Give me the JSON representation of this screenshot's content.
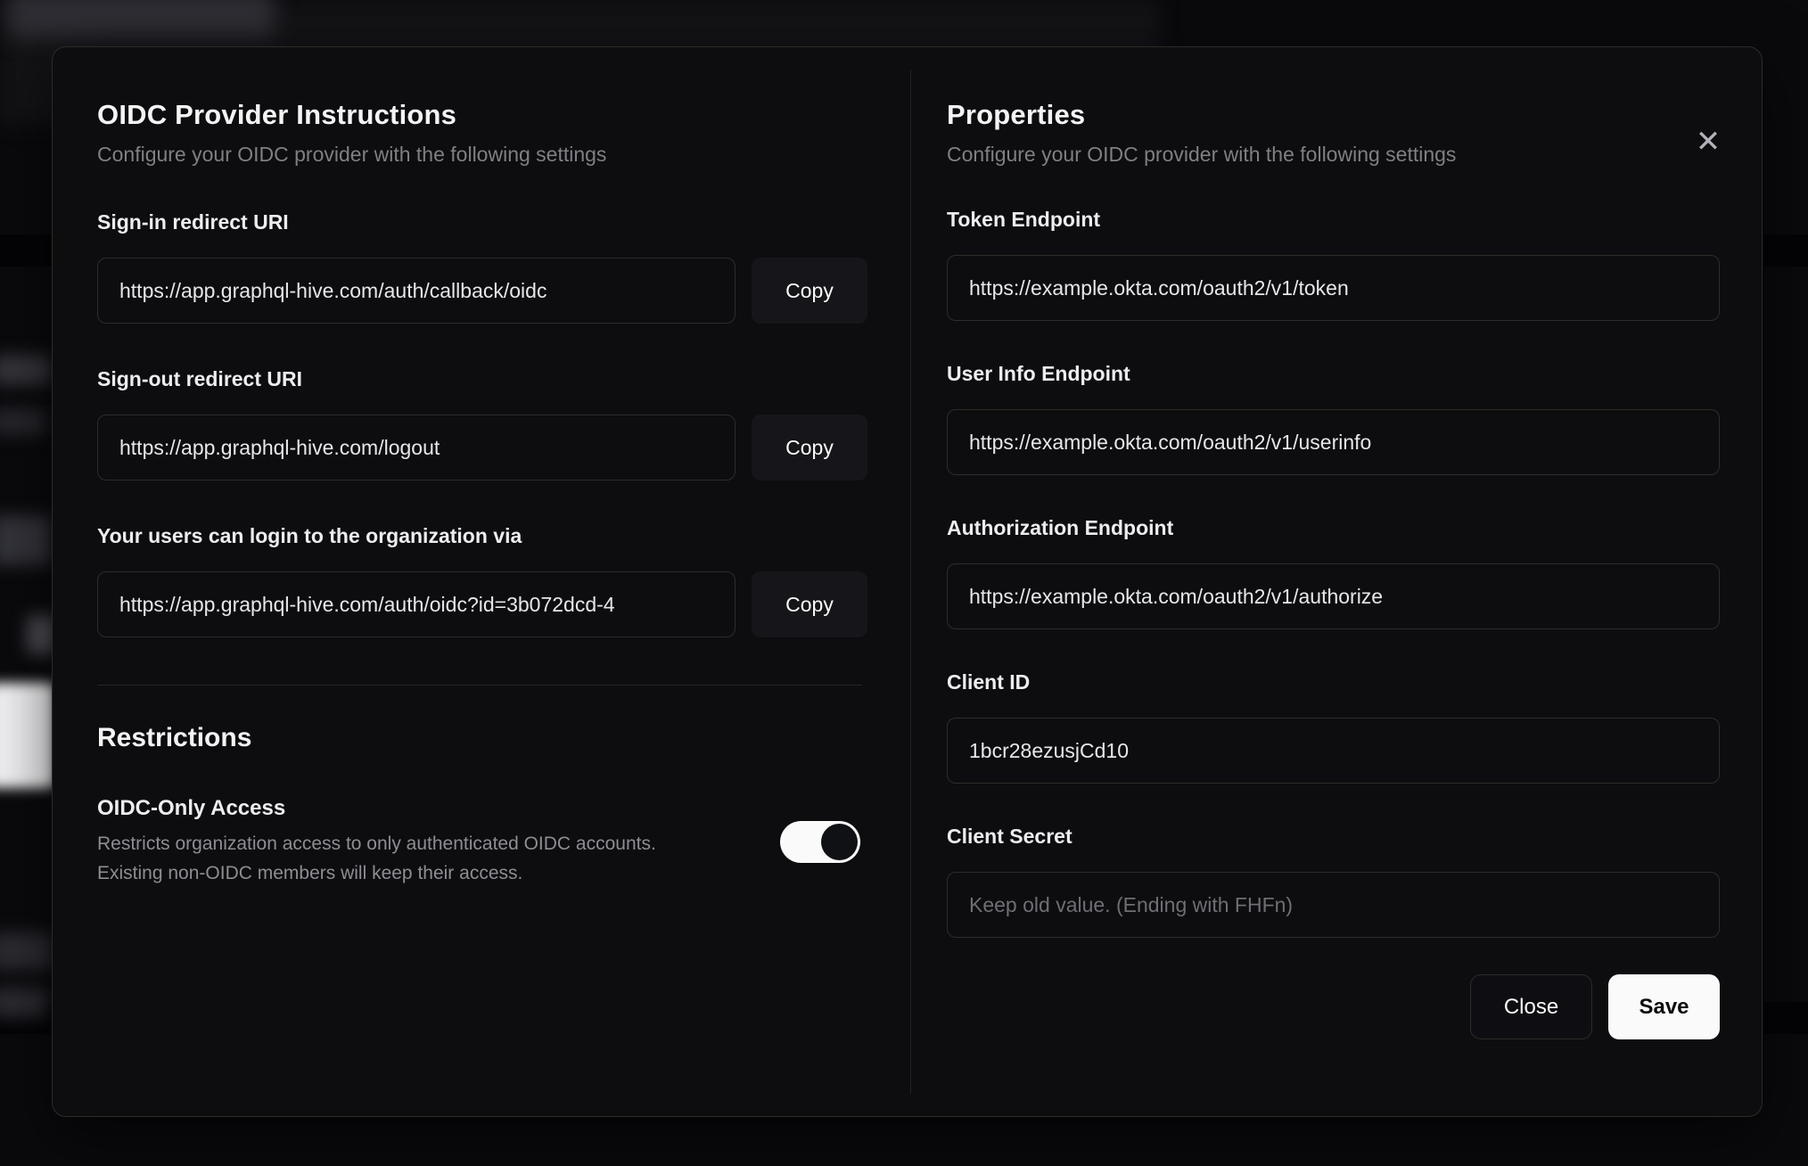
{
  "modal": {
    "close_icon": "✕",
    "left": {
      "title": "OIDC Provider Instructions",
      "subtitle": "Configure your OIDC provider with the following settings",
      "fields": [
        {
          "label": "Sign-in redirect URI",
          "value": "https://app.graphql-hive.com/auth/callback/oidc",
          "copy_label": "Copy"
        },
        {
          "label": "Sign-out redirect URI",
          "value": "https://app.graphql-hive.com/logout",
          "copy_label": "Copy"
        },
        {
          "label": "Your users can login to the organization via",
          "value": "https://app.graphql-hive.com/auth/oidc?id=3b072dcd-4",
          "copy_label": "Copy"
        }
      ],
      "restrictions": {
        "title": "Restrictions",
        "toggle_label": "OIDC-Only Access",
        "toggle_description": "Restricts organization access to only authenticated OIDC accounts. Existing non-OIDC members will keep their access.",
        "toggle_state": "on"
      }
    },
    "right": {
      "title": "Properties",
      "subtitle": "Configure your OIDC provider with the following settings",
      "fields": [
        {
          "label": "Token Endpoint",
          "value": "https://example.okta.com/oauth2/v1/token"
        },
        {
          "label": "User Info Endpoint",
          "value": "https://example.okta.com/oauth2/v1/userinfo"
        },
        {
          "label": "Authorization Endpoint",
          "value": "https://example.okta.com/oauth2/v1/authorize"
        },
        {
          "label": "Client ID",
          "value": "1bcr28ezusjCd10"
        },
        {
          "label": "Client Secret",
          "value": "",
          "placeholder": "Keep old value. (Ending with FHFn)"
        }
      ],
      "footer": {
        "close_label": "Close",
        "save_label": "Save"
      }
    }
  },
  "colors": {
    "modal_background": "#0d0d10",
    "accent_button": "#fafafa",
    "toggle_on_track": "#fafafa",
    "input_border": "#2f2c26"
  }
}
